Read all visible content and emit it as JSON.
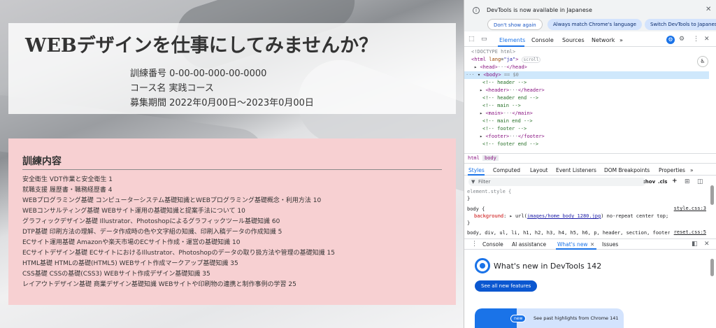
{
  "hero": {
    "title": "WEBデザインを仕事にしてみませんか？",
    "info": [
      "訓練番号 0-00-00-000-00-0000",
      "コース名 実践コース",
      "募集期間 2022年0月00日〜2023年0月00日"
    ]
  },
  "training": {
    "heading": "訓練内容",
    "items": [
      "安全衛生 VDT作業と安全衛生 1",
      "就職支援 履歴書・職務経歴書 4",
      "WEBプログラミング基礎 コンピューターシステム基礎知識とWEBプログラミング基礎概念・利用方法 10",
      "WEBコンサルティング基礎 WEBサイト運用の基礎知識と提案手法について 10",
      "グラフィックデザイン基礎 Illustrator、Photoshopによるグラフィックツール基礎知識 60",
      "DTP基礎 印刷方法の理解、データ作成時の色や文字組の知識、印刷入稿データの作成知識 5",
      "ECサイト運用基礎 Amazonや楽天市場のECサイト作成・運営の基礎知識 10",
      "ECサイトデザイン基礎 ECサイトにおけるIllustrator、Photoshopのデータの取り扱方法や管理の基礎知識 15",
      "HTML基礎 HTMLの基礎(HTML5) WEBサイト作成マークアップ基礎知識 35",
      "CSS基礎 CSSの基礎(CSS3) WEBサイト作成デザイン基礎知識 35",
      "レイアウトデザイン基礎 商業デザイン基礎知識 WEBサイトや印刷物の連携と制作事例の学習 25"
    ],
    "bg_color": "#f7d0d2"
  },
  "devtools": {
    "infobar": {
      "text": "DevTools is now available in Japanese",
      "dont_show": "Don't show again",
      "match": "Always match Chrome's language",
      "switch": "Switch DevTools to Japanese"
    },
    "main_tabs": [
      "Elements",
      "Console",
      "Sources",
      "Network",
      "»"
    ],
    "dom": {
      "doctype": "<!DOCTYPE html>",
      "html_open": "<html",
      "html_lang_attr": "lang",
      "html_lang_val": "\"ja\"",
      "html_close": ">",
      "scroll_badge": "scroll",
      "head": "<head>",
      "head_end": "</head>",
      "body": "<body>",
      "body_eq": "== $0",
      "c_header": "<!-- header -->",
      "header": "<header>",
      "header_end": "</header>",
      "c_header_end": "<!-- header end -->",
      "c_main": "<!-- main -->",
      "main": "<main>",
      "main_end": "</main>",
      "c_main_end": "<!-- main end -->",
      "c_footer": "<!-- footer -->",
      "footer": "<footer>",
      "footer_end": "</footer>",
      "c_footer_end": "<!-- footer end -->",
      "ellipsis": "···"
    },
    "crumbs": [
      "html",
      "body"
    ],
    "style_tabs": [
      "Styles",
      "Computed",
      "Layout",
      "Event Listeners",
      "DOM Breakpoints",
      "Properties",
      "»"
    ],
    "filter_placeholder": "Filter",
    "filter_opts": [
      ":hov",
      ".cls",
      "+"
    ],
    "styles": {
      "element_style": "element.style {",
      "close1": "}",
      "body_selector": "body {",
      "body_source": "style.css:3",
      "bg_prop": "background",
      "bg_val_pre": "url(",
      "bg_url": "images/home body 1280.jpg",
      "bg_val_post": ") no-repeat center top;",
      "close2": "}",
      "reset_selector": "body, div, ul, li, h1, h2, h3, h4, h5, h6, p, header, section, footer {",
      "reset_source": "reset.css:5"
    },
    "drawer_tabs": [
      "Console",
      "AI assistance",
      "What's new",
      "Issues"
    ],
    "whatsnew": {
      "title": "What's new in DevTools 142",
      "see_all": "See all new features",
      "card_badge": "new",
      "card_text": "See past highlights from Chrome 141"
    },
    "colors": {
      "accent": "#1a73e8",
      "tag": "#881280",
      "comment": "#236e25"
    }
  }
}
